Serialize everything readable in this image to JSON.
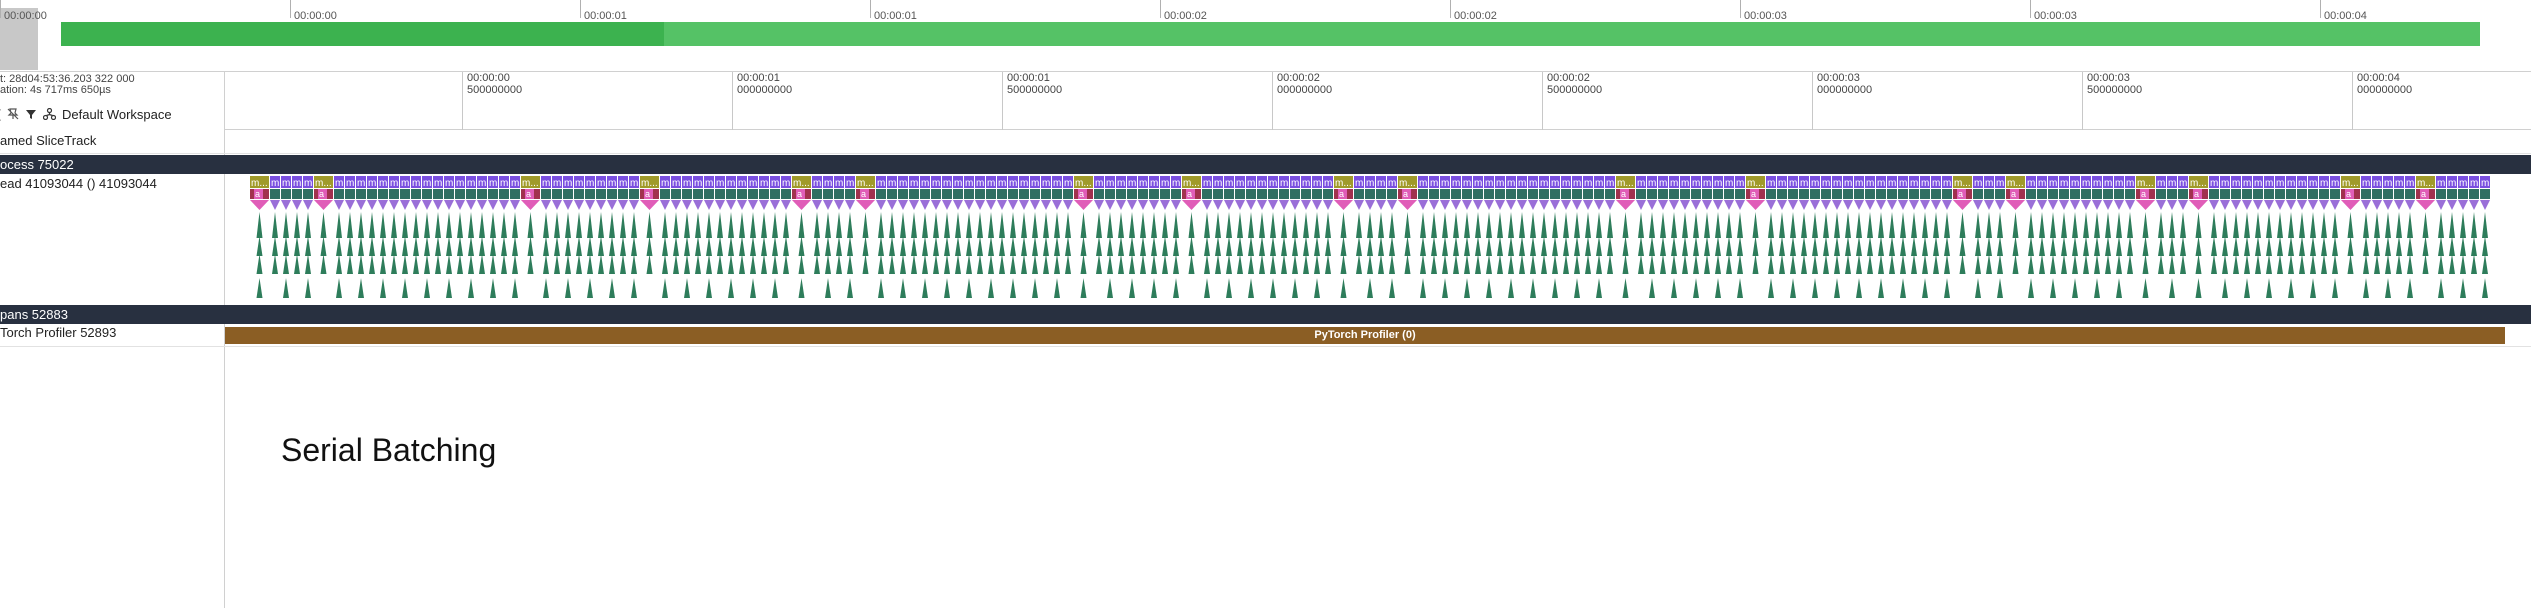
{
  "overview": {
    "ticks": [
      "00:00:00",
      "00:00:00",
      "00:00:01",
      "00:00:01",
      "00:00:02",
      "00:00:02",
      "00:00:03",
      "00:00:03",
      "00:00:04"
    ]
  },
  "info": {
    "start_line": "t: 28d04:53:36.203 322 000",
    "duration_line": "ation: 4s 717ms 650µs"
  },
  "toolbar": {
    "workspace_label": "Default Workspace"
  },
  "ruler": {
    "ticks": [
      {
        "time": "00:00:00",
        "ns": "500000000"
      },
      {
        "time": "00:00:01",
        "ns": "000000000"
      },
      {
        "time": "00:00:01",
        "ns": "500000000"
      },
      {
        "time": "00:00:02",
        "ns": "000000000"
      },
      {
        "time": "00:00:02",
        "ns": "500000000"
      },
      {
        "time": "00:00:03",
        "ns": "000000000"
      },
      {
        "time": "00:00:03",
        "ns": "500000000"
      },
      {
        "time": "00:00:04",
        "ns": "000000000"
      }
    ]
  },
  "tracks": {
    "named_slice": "amed SliceTrack",
    "process": "ocess 75022",
    "thread": "ead 41093044 () 41093044",
    "spans": "pans 52883",
    "profiler_track": "Torch Profiler 52893"
  },
  "profiler_slice": "PyTorch Profiler (0)",
  "flame": {
    "slice_letter": "m",
    "wide_slice_label": "m...",
    "marker_letter": "a"
  },
  "annotation": "Serial Batching",
  "colors": {
    "overview_bar": "#55c266",
    "overview_bar_dark": "#3cb24f",
    "slice_purple": "#7a4fe0",
    "slice_olive": "#a09a2a",
    "depth2_maroon": "#a1314e",
    "depth2_green": "#2f6f62",
    "marker_pink": "#e05db8",
    "spike_green": "#2e7d5b",
    "dark_row": "#283040",
    "profiler_bar": "#8b5e24"
  }
}
